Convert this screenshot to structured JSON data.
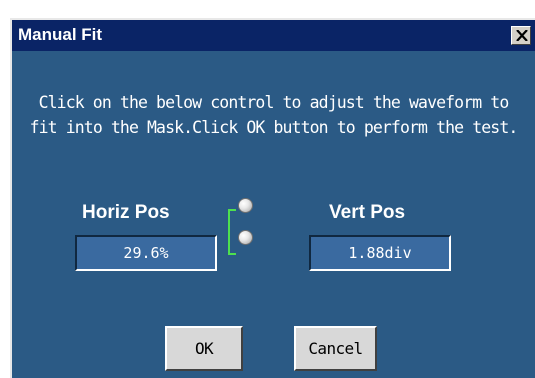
{
  "window": {
    "title": "Manual Fit",
    "close_icon": "close-x-icon"
  },
  "instruction": {
    "line1": "Click on the below control to adjust the waveform to",
    "line2": "fit into the Mask.Click OK button to perform the test."
  },
  "horiz": {
    "label": "Horiz Pos",
    "value": "29.6%"
  },
  "vert": {
    "label": "Vert Pos",
    "value": "1.88div"
  },
  "buttons": {
    "ok": "OK",
    "cancel": "Cancel"
  },
  "colors": {
    "dialog_bg": "#2b5a85",
    "titlebar": "#0a2466",
    "bracket": "#4ee04e"
  }
}
